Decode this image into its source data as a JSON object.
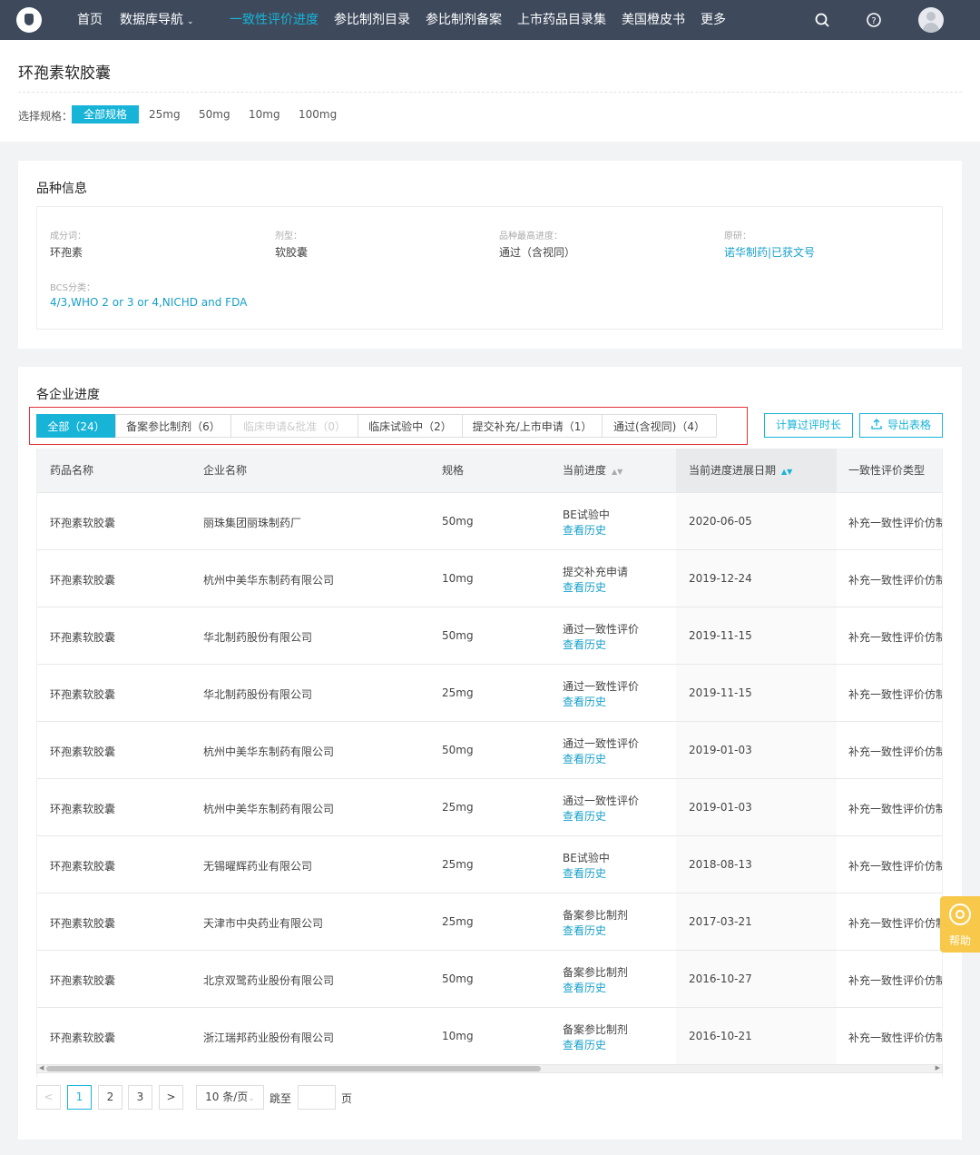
{
  "nav": {
    "home": "首页",
    "database": "数据库导航",
    "consistency": "一致性评价进度",
    "catalog": "参比制剂目录",
    "filing": "参比制剂备案",
    "marketed": "上市药品目录集",
    "orange_book": "美国橙皮书",
    "more": "更多",
    "search_icon": "search-icon",
    "help_icon": "question-icon",
    "avatar_icon": "user-icon"
  },
  "page": {
    "title": "环孢素软胶囊",
    "spec_label": "选择规格：",
    "specs": [
      "全部规格",
      "25mg",
      "50mg",
      "10mg",
      "100mg"
    ]
  },
  "variety": {
    "title": "品种信息",
    "ingredient_label": "成分词：",
    "ingredient": "环孢素",
    "form_label": "剂型：",
    "form": "软胶囊",
    "progress_label": "品种最高进度：",
    "progress": "通过（含视同）",
    "original_label": "原研：",
    "original": "诺华制药|已获文号",
    "bcs_label": "BCS分类：",
    "bcs": "4/3,WHO 2 or 3 or 4,NICHD and FDA"
  },
  "progress": {
    "title": "各企业进度",
    "tabs": [
      "全部（24）",
      "备案参比制剂（6）",
      "临床申请&批准（0）",
      "临床试验中（2）",
      "提交补充/上市申请（1）",
      "通过(含视同)（4）"
    ],
    "calc_button": "计算过评时长",
    "export_button": "导出表格",
    "columns": [
      "药品名称",
      "企业名称",
      "规格",
      "当前进度",
      "当前进度进展日期",
      "一致性评价类型"
    ],
    "history_link": "查看历史",
    "rows": [
      {
        "name": "环孢素软胶囊",
        "company": "丽珠集团丽珠制药厂",
        "spec": "50mg",
        "status": "BE试验中",
        "date": "2020-06-05",
        "type": "补充一致性评价仿制"
      },
      {
        "name": "环孢素软胶囊",
        "company": "杭州中美华东制药有限公司",
        "spec": "10mg",
        "status": "提交补充申请",
        "date": "2019-12-24",
        "type": "补充一致性评价仿制"
      },
      {
        "name": "环孢素软胶囊",
        "company": "华北制药股份有限公司",
        "spec": "50mg",
        "status": "通过一致性评价",
        "date": "2019-11-15",
        "type": "补充一致性评价仿制"
      },
      {
        "name": "环孢素软胶囊",
        "company": "华北制药股份有限公司",
        "spec": "25mg",
        "status": "通过一致性评价",
        "date": "2019-11-15",
        "type": "补充一致性评价仿制"
      },
      {
        "name": "环孢素软胶囊",
        "company": "杭州中美华东制药有限公司",
        "spec": "50mg",
        "status": "通过一致性评价",
        "date": "2019-01-03",
        "type": "补充一致性评价仿制"
      },
      {
        "name": "环孢素软胶囊",
        "company": "杭州中美华东制药有限公司",
        "spec": "25mg",
        "status": "通过一致性评价",
        "date": "2019-01-03",
        "type": "补充一致性评价仿制"
      },
      {
        "name": "环孢素软胶囊",
        "company": "无锡曜辉药业有限公司",
        "spec": "25mg",
        "status": "BE试验中",
        "date": "2018-08-13",
        "type": "补充一致性评价仿制"
      },
      {
        "name": "环孢素软胶囊",
        "company": "天津市中央药业有限公司",
        "spec": "25mg",
        "status": "备案参比制剂",
        "date": "2017-03-21",
        "type": "补充一致性评价仿制"
      },
      {
        "name": "环孢素软胶囊",
        "company": "北京双鹭药业股份有限公司",
        "spec": "50mg",
        "status": "备案参比制剂",
        "date": "2016-10-27",
        "type": "补充一致性评价仿制"
      },
      {
        "name": "环孢素软胶囊",
        "company": "浙江瑞邦药业股份有限公司",
        "spec": "10mg",
        "status": "备案参比制剂",
        "date": "2016-10-21",
        "type": "补充一致性评价仿制"
      }
    ]
  },
  "pagination": {
    "prev": "<",
    "pages": [
      "1",
      "2",
      "3"
    ],
    "next": ">",
    "page_size": "10 条/页",
    "jump_label": "跳至",
    "page_unit": "页"
  },
  "help": {
    "label": "帮助"
  },
  "colors": {
    "accent": "#17b4d8",
    "nav_bg": "#3e4a5c",
    "highlight_border": "#e2333c",
    "help": "#f8c84a"
  }
}
